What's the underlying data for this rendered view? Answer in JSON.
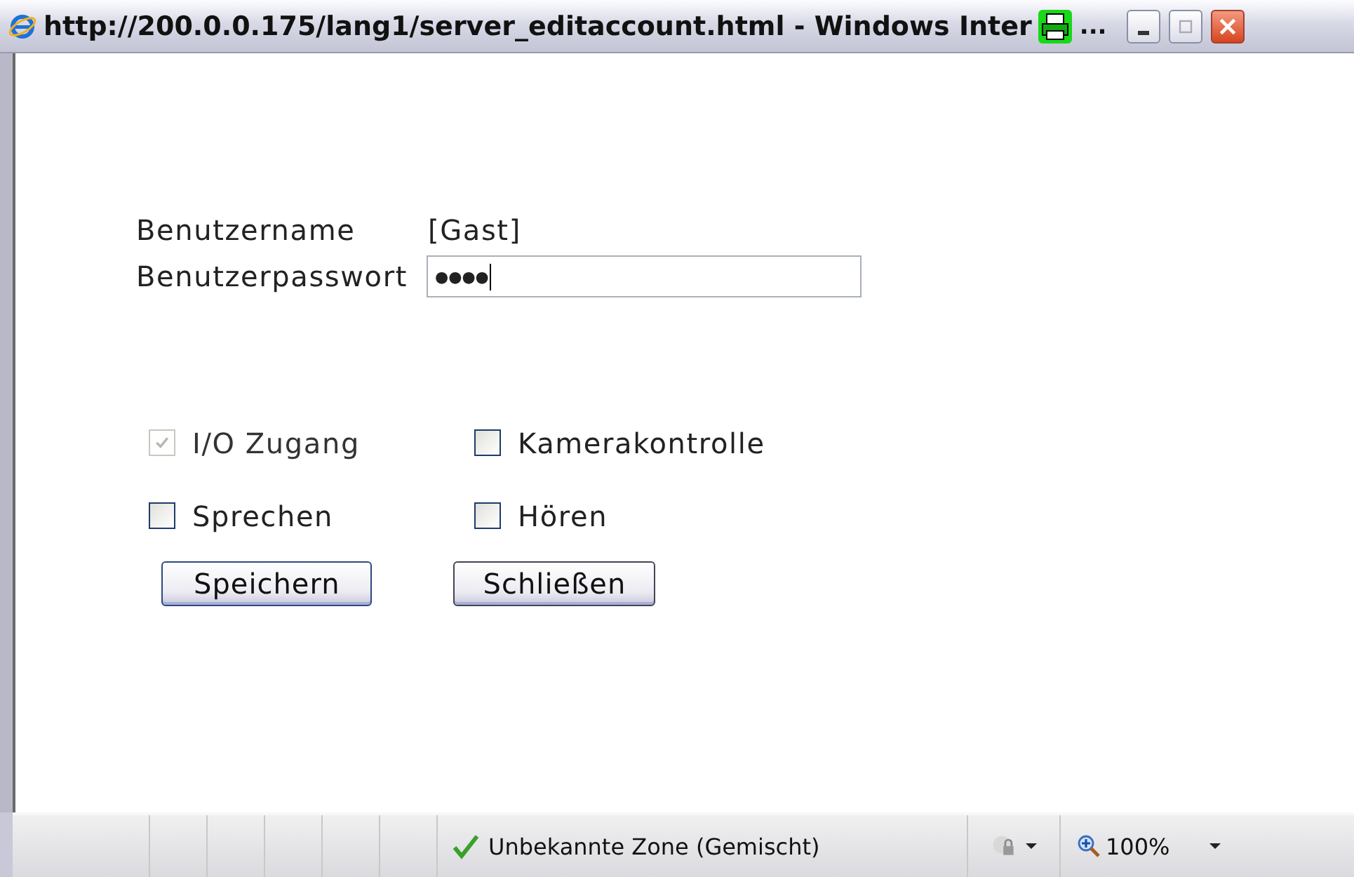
{
  "window": {
    "title": "http://200.0.0.175/lang1/server_editaccount.html - Windows Inter",
    "title_ellipsis": "..."
  },
  "form": {
    "username_label": "Benutzername",
    "username_value": "[Gast]",
    "password_label": "Benutzerpasswort",
    "password_value": "●●●●"
  },
  "permissions": [
    {
      "label": "I/O Zugang",
      "checked": true,
      "disabled": true
    },
    {
      "label": "Kamerakontrolle",
      "checked": false,
      "disabled": false
    },
    {
      "label": "Sprechen",
      "checked": false,
      "disabled": false
    },
    {
      "label": "Hören",
      "checked": false,
      "disabled": false
    }
  ],
  "buttons": [
    "Speichern",
    "Schließen"
  ],
  "status_bar": {
    "zone": "Unbekannte Zone (Gemischt)",
    "zoom": "100%"
  }
}
